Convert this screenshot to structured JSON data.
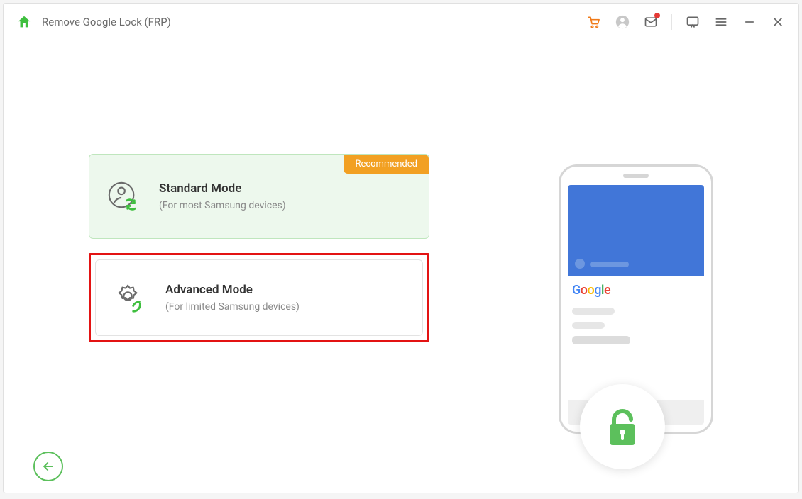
{
  "header": {
    "title": "Remove Google Lock (FRP)"
  },
  "modes": {
    "recommended_badge": "Recommended",
    "standard": {
      "title": "Standard Mode",
      "subtitle": "(For most Samsung devices)"
    },
    "advanced": {
      "title": "Advanced Mode",
      "subtitle": "(For limited Samsung devices)"
    }
  },
  "illustration": {
    "logo_text": "Google"
  }
}
